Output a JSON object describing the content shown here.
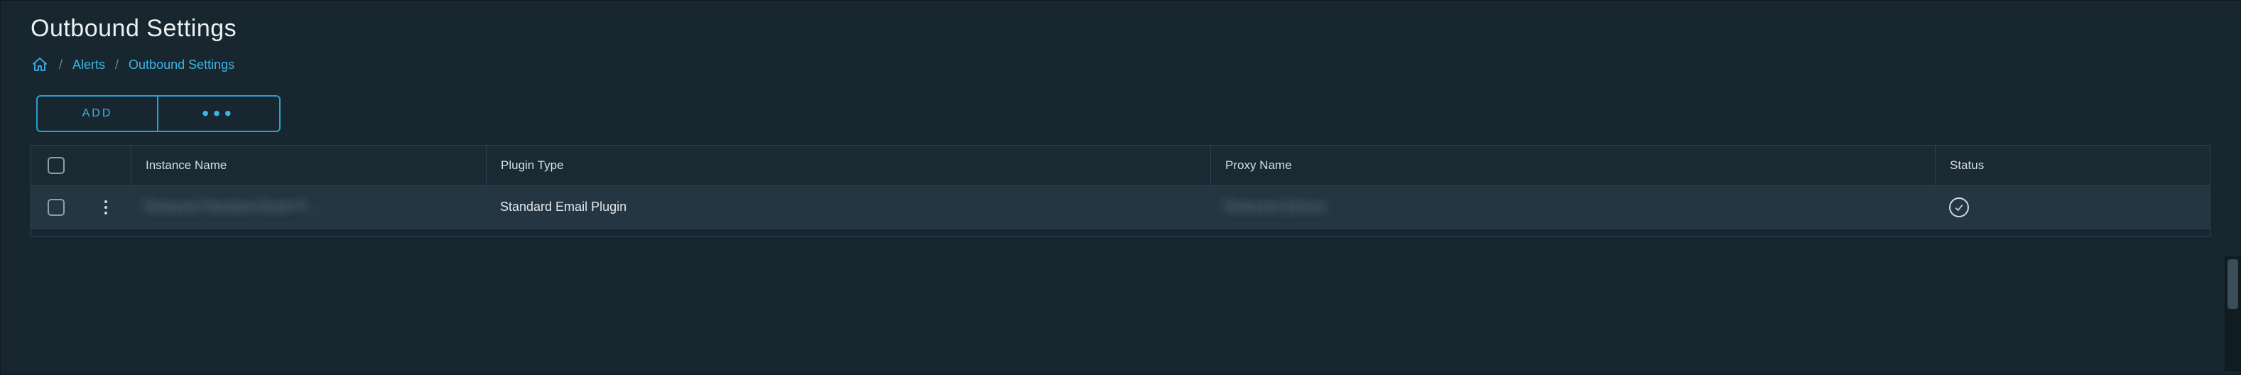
{
  "page_title": "Outbound Settings",
  "breadcrumbs": {
    "home_aria": "Home",
    "alerts": "Alerts",
    "current": "Outbound Settings"
  },
  "toolbar": {
    "add_label": "ADD",
    "more_label": "•••"
  },
  "table": {
    "columns": {
      "instance_name": "Instance Name",
      "plugin_type": "Plugin Type",
      "proxy_name": "Proxy Name",
      "status": "Status"
    },
    "rows": [
      {
        "instance_name_redacted": "Redacted Standard Email Pl…",
        "plugin_type": "Standard Email Plugin",
        "proxy_name_redacted": "Redacted (Demo)",
        "status": "ok"
      }
    ]
  }
}
